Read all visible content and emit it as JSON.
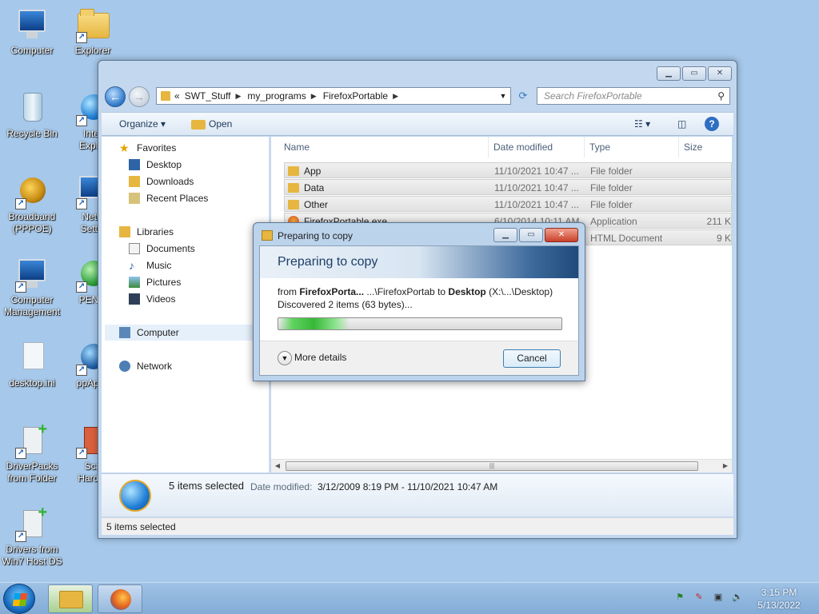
{
  "desktop": {
    "icons": [
      {
        "label": "Computer"
      },
      {
        "label": "Explorer"
      },
      {
        "label": "Recycle Bin"
      },
      {
        "label": "Inter Explor"
      },
      {
        "label": "Broadband (PPPOE)"
      },
      {
        "label": "Netw Settin"
      },
      {
        "label": "Computer Management"
      },
      {
        "label": "PENet"
      },
      {
        "label": "desktop.ini"
      },
      {
        "label": "ppApps"
      },
      {
        "label": "DriverPacks from Folder"
      },
      {
        "label": "Sca HardW"
      },
      {
        "label": "Drivers from Win7 Host DS"
      }
    ]
  },
  "explorer": {
    "breadcrumb": [
      "«",
      "SWT_Stuff",
      "my_programs",
      "FirefoxPortable"
    ],
    "search_placeholder": "Search FirefoxPortable",
    "toolbar": {
      "organize": "Organize",
      "open": "Open"
    },
    "nav": {
      "favorites": "Favorites",
      "desktop": "Desktop",
      "downloads": "Downloads",
      "recent": "Recent Places",
      "libraries": "Libraries",
      "documents": "Documents",
      "music": "Music",
      "pictures": "Pictures",
      "videos": "Videos",
      "computer": "Computer",
      "network": "Network"
    },
    "columns": {
      "name": "Name",
      "date": "Date modified",
      "type": "Type",
      "size": "Size"
    },
    "rows": [
      {
        "name": "App",
        "date": "11/10/2021 10:47 ...",
        "type": "File folder",
        "size": ""
      },
      {
        "name": "Data",
        "date": "11/10/2021 10:47 ...",
        "type": "File folder",
        "size": ""
      },
      {
        "name": "Other",
        "date": "11/10/2021 10:47 ...",
        "type": "File folder",
        "size": ""
      },
      {
        "name": "FirefoxPortable.exe",
        "date": "6/10/2014 10:11 AM",
        "type": "Application",
        "size": "211 K"
      },
      {
        "name": "",
        "date": "",
        "type": "HTML Document",
        "size": "9 K"
      }
    ],
    "details": {
      "selection": "5 items selected",
      "date_label": "Date modified:",
      "date_value": "3/12/2009 8:19 PM - 11/10/2021 10:47 AM"
    },
    "status": "5 items selected"
  },
  "copy_dialog": {
    "title": "Preparing to copy",
    "heading": "Preparing to copy",
    "from_prefix": "from ",
    "from_name": "FirefoxPorta...",
    "from_path": "  ...\\FirefoxPortab to ",
    "to_name": "Desktop",
    "to_path": " (X:\\...\\Desktop)",
    "discovered": "Discovered 2 items (63 bytes)...",
    "progress": 0.25,
    "more_details": "More details",
    "cancel": "Cancel"
  },
  "taskbar": {
    "time": "3:15 PM",
    "date": "5/13/2022"
  }
}
